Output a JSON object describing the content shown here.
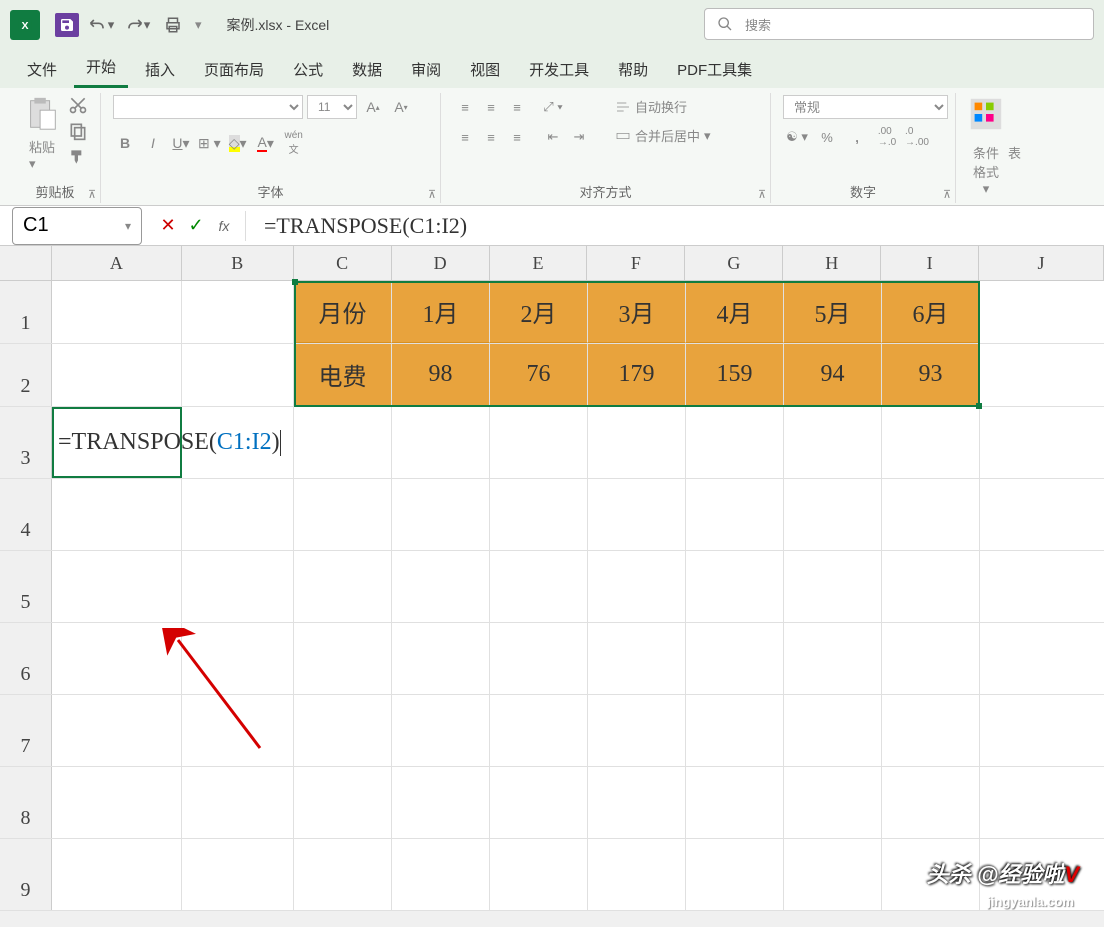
{
  "title_bar": {
    "filename": "案例.xlsx",
    "app": "Excel",
    "search_placeholder": "搜索"
  },
  "tabs": {
    "file": "文件",
    "home": "开始",
    "insert": "插入",
    "layout": "页面布局",
    "formulas": "公式",
    "data": "数据",
    "review": "审阅",
    "view": "视图",
    "developer": "开发工具",
    "help": "帮助",
    "pdf": "PDF工具集"
  },
  "ribbon": {
    "clipboard": {
      "label": "剪贴板",
      "paste": "粘贴"
    },
    "font": {
      "label": "字体",
      "size": "11",
      "wen": "wén"
    },
    "alignment": {
      "label": "对齐方式",
      "wrap": "自动换行",
      "merge": "合并后居中"
    },
    "number": {
      "label": "数字",
      "format": "常规"
    },
    "cond": {
      "label": "条件格式",
      "table": "表"
    }
  },
  "formula_bar": {
    "name_box": "C1",
    "formula": "=TRANSPOSE(C1:I2)"
  },
  "columns": [
    "A",
    "B",
    "C",
    "D",
    "E",
    "F",
    "G",
    "H",
    "I",
    "J"
  ],
  "rows": [
    "1",
    "2",
    "3",
    "4",
    "5",
    "6",
    "7",
    "8",
    "9"
  ],
  "chart_data": {
    "type": "table",
    "row1": {
      "label": "月份",
      "values": [
        "1月",
        "2月",
        "3月",
        "4月",
        "5月",
        "6月"
      ]
    },
    "row2": {
      "label": "电费",
      "values": [
        "98",
        "76",
        "179",
        "159",
        "94",
        "93"
      ]
    }
  },
  "edit_cell": {
    "prefix": "=TRANSPOSE(",
    "ref": "C1:I2",
    "suffix": ")"
  },
  "watermark": {
    "line1_a": "头杀 @",
    "line1_b": "经验啦",
    "line1_c": "V",
    "line2": "jingyanla.com"
  }
}
